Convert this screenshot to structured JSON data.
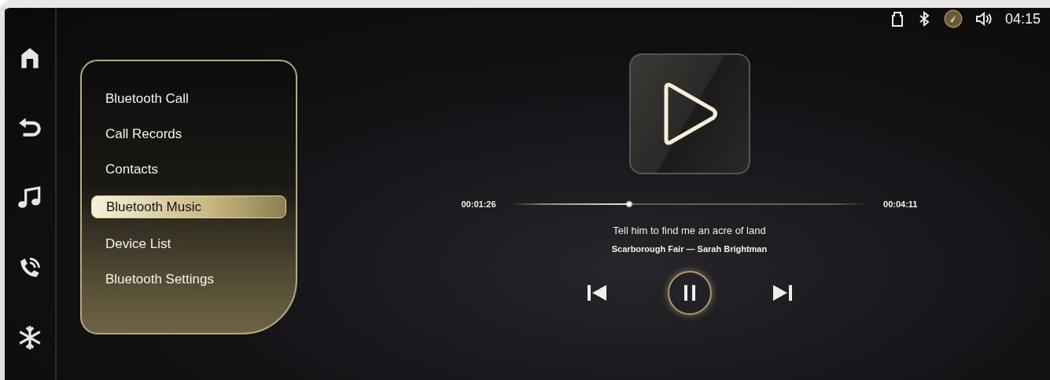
{
  "status_bar": {
    "time": "04:15"
  },
  "menu": {
    "items": [
      {
        "label": "Bluetooth Call",
        "selected": false
      },
      {
        "label": "Call Records",
        "selected": false
      },
      {
        "label": "Contacts",
        "selected": false
      },
      {
        "label": "Bluetooth Music",
        "selected": true
      },
      {
        "label": "Device List",
        "selected": false
      },
      {
        "label": "Bluetooth Settings",
        "selected": false
      }
    ]
  },
  "player": {
    "elapsed": "00:01:26",
    "duration": "00:04:11",
    "level": 0.33,
    "lyric": "Tell him to find me an acre of land",
    "track": "Scarborough Fair — Sarah Brightman",
    "playing": true
  }
}
